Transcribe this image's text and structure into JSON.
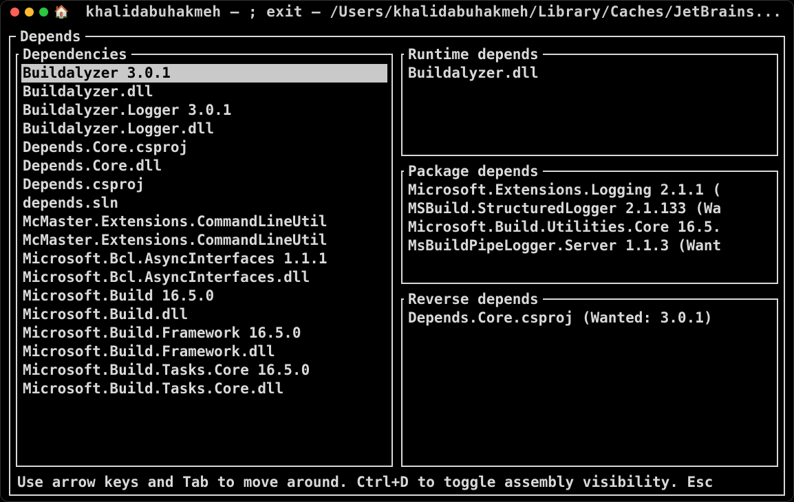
{
  "titlebar": {
    "title": "khalidabuhakmeh — ; exit — /Users/khalidabuhakmeh/Library/Caches/JetBrains..."
  },
  "outer_legend": "Depends",
  "panels": {
    "dependencies": {
      "legend": "Dependencies",
      "selected_index": 0,
      "items": [
        "Buildalyzer 3.0.1",
        "Buildalyzer.dll",
        "Buildalyzer.Logger 3.0.1",
        "Buildalyzer.Logger.dll",
        "Depends.Core.csproj",
        "Depends.Core.dll",
        "Depends.csproj",
        "depends.sln",
        "McMaster.Extensions.CommandLineUtil",
        "McMaster.Extensions.CommandLineUtil",
        "Microsoft.Bcl.AsyncInterfaces 1.1.1",
        "Microsoft.Bcl.AsyncInterfaces.dll",
        "Microsoft.Build 16.5.0",
        "Microsoft.Build.dll",
        "Microsoft.Build.Framework 16.5.0",
        "Microsoft.Build.Framework.dll",
        "Microsoft.Build.Tasks.Core 16.5.0",
        "Microsoft.Build.Tasks.Core.dll"
      ]
    },
    "runtime": {
      "legend": "Runtime depends",
      "items": [
        "Buildalyzer.dll"
      ]
    },
    "package": {
      "legend": "Package depends",
      "items": [
        "Microsoft.Extensions.Logging 2.1.1 (",
        "MSBuild.StructuredLogger 2.1.133 (Wa",
        "Microsoft.Build.Utilities.Core 16.5.",
        "MsBuildPipeLogger.Server 1.1.3 (Want"
      ]
    },
    "reverse": {
      "legend": "Reverse depends",
      "items": [
        "Depends.Core.csproj (Wanted: 3.0.1)"
      ]
    }
  },
  "statusbar": "Use arrow keys and Tab to move around. Ctrl+D to toggle assembly visibility. Esc"
}
